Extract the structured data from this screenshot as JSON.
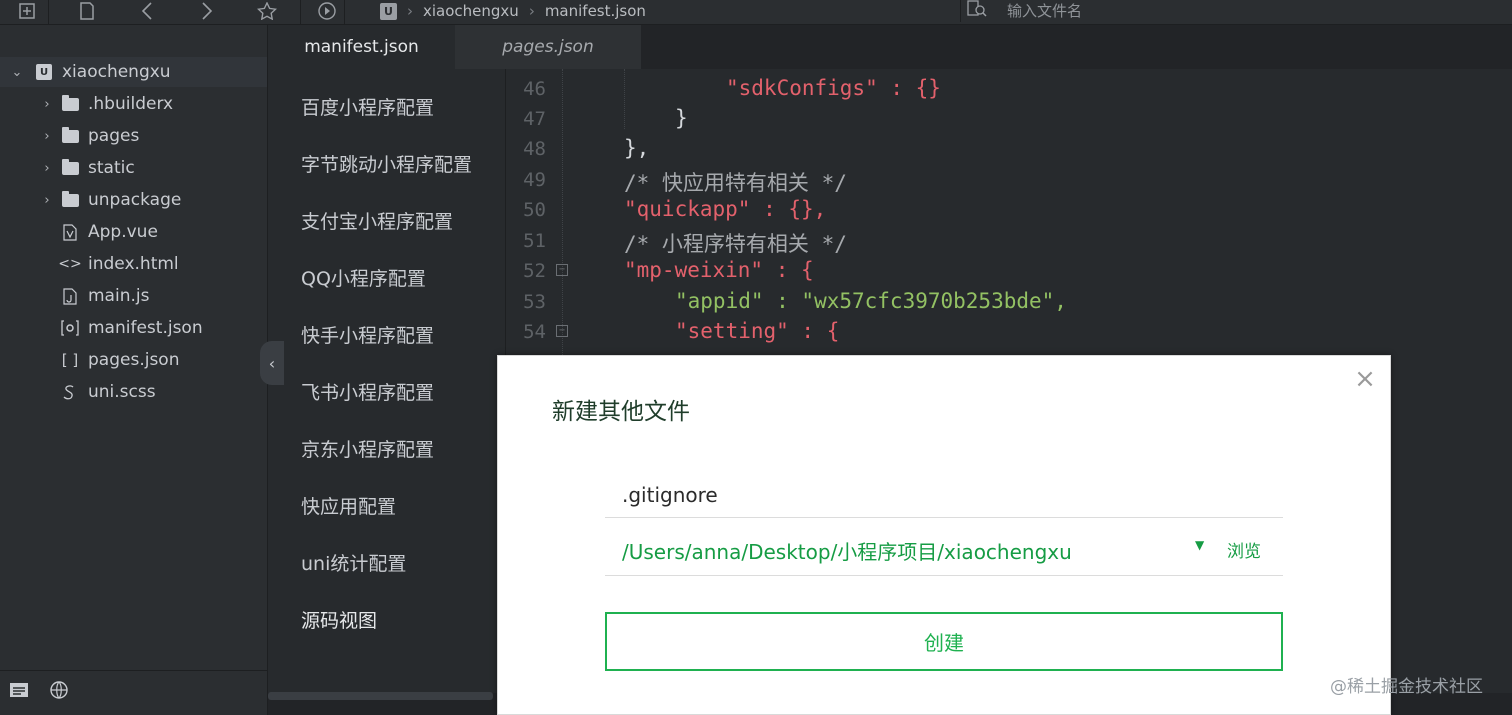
{
  "toolbar": {
    "icons": [
      "new-file-icon",
      "save-icon",
      "back-icon",
      "forward-icon",
      "star-icon",
      "run-icon"
    ],
    "breadcrumb": {
      "logo": "U",
      "project": "xiaochengxu",
      "separator": "›",
      "file": "manifest.json"
    },
    "search": {
      "placeholder": "输入文件名",
      "icon": "search-icon"
    }
  },
  "sidebar": {
    "root": {
      "label": "xiaochengxu",
      "logo": "U"
    },
    "items": [
      {
        "label": ".hbuilderx",
        "type": "folder"
      },
      {
        "label": "pages",
        "type": "folder"
      },
      {
        "label": "static",
        "type": "folder"
      },
      {
        "label": "unpackage",
        "type": "folder"
      },
      {
        "label": "App.vue",
        "type": "file",
        "glyph": "🗎"
      },
      {
        "label": "index.html",
        "type": "file",
        "glyph": "<>"
      },
      {
        "label": "main.js",
        "type": "file",
        "glyph": "🗎"
      },
      {
        "label": "manifest.json",
        "type": "file",
        "glyph": "⚙"
      },
      {
        "label": "pages.json",
        "type": "file",
        "glyph": "[ ]"
      },
      {
        "label": "uni.scss",
        "type": "file",
        "glyph": "∮"
      }
    ],
    "footer_icons": [
      "project-manager-icon",
      "browser-icon"
    ]
  },
  "tabs": [
    {
      "label": "manifest.json",
      "active": true
    },
    {
      "label": "pages.json",
      "active": false
    }
  ],
  "config_menu": [
    "百度小程序配置",
    "字节跳动小程序配置",
    "支付宝小程序配置",
    "QQ小程序配置",
    "快手小程序配置",
    "飞书小程序配置",
    "京东小程序配置",
    "快应用配置",
    "uni统计配置",
    "源码视图"
  ],
  "code_lines": [
    {
      "num": "46",
      "text": "\"sdkConfigs\" : {}",
      "fold": false
    },
    {
      "num": "47",
      "text": "}",
      "fold": false
    },
    {
      "num": "48",
      "text": "},",
      "fold": false
    },
    {
      "num": "49",
      "text": "/* 快应用特有相关 */",
      "fold": false
    },
    {
      "num": "50",
      "text": "\"quickapp\" : {},",
      "fold": false
    },
    {
      "num": "51",
      "text": "/* 小程序特有相关 */",
      "fold": false
    },
    {
      "num": "52",
      "text": "\"mp-weixin\" : {",
      "fold": true
    },
    {
      "num": "53",
      "text": "\"appid\" : \"wx57cfc3970b253bde\",",
      "fold": false
    },
    {
      "num": "54",
      "text": "\"setting\" : {",
      "fold": true
    }
  ],
  "dialog": {
    "title": "新建其他文件",
    "filename_value": ".gitignore",
    "path": "/Users/anna/Desktop/小程序项目/xiaochengxu",
    "dropdown_glyph": "▼",
    "browse_label": "浏览",
    "create_label": "创建",
    "close_glyph": "×"
  },
  "collapse_glyph": "‹",
  "watermark": "@稀土掘金技术社区",
  "colors": {
    "accent_green": "#1fb150",
    "path_green": "#169c44",
    "key_red": "#e3616c",
    "string_green": "#93c163",
    "background": "#272a2d"
  }
}
